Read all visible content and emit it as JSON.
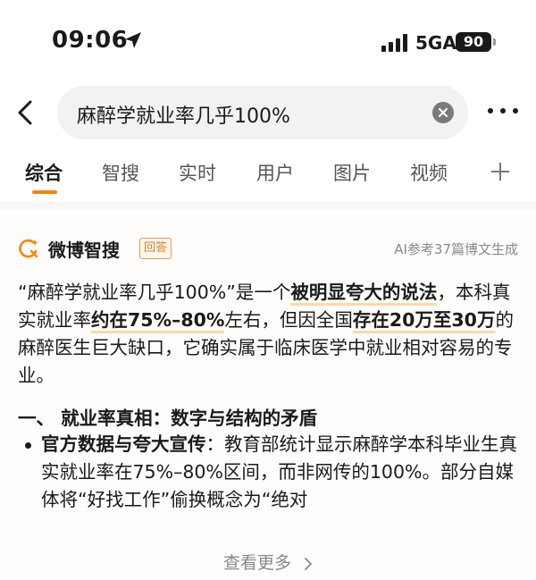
{
  "status_bar": {
    "time": "09:06",
    "network": "5GA",
    "battery": "90"
  },
  "search": {
    "query": "麻醉学就业率几乎100%"
  },
  "tabs": [
    "综合",
    "智搜",
    "实时",
    "用户",
    "图片",
    "视频"
  ],
  "card": {
    "brand": "微博智搜",
    "badge": "回答",
    "ai_note": "AI参考37篇博文生成",
    "intro": {
      "p1": "“麻醉学就业率几乎100%”是一个",
      "h1": "被明显夸大的说法",
      "p2": "，本科真实就业率",
      "h2": "约在75%–80%",
      "p3": "左右，但因全国",
      "h3": "存在20万至30万",
      "p4": "的麻醉医生巨大缺口，它确实属于临床医学中就业相对容易的专业。"
    },
    "heading": "一、 就业率真相：数字与结构的矛盾",
    "bullet": {
      "label": "官方数据与夸大宣传",
      "text": "：教育部统计显示麻醉学本科毕业生真实就业率在75%–80%区间，而非网传的100%。部分自媒体将“好找工作”偷换概念为“绝对"
    },
    "view_more": "查看更多"
  },
  "icons": [
    "location-arrow-icon",
    "signal-icon",
    "back-icon",
    "clear-icon",
    "more-icon",
    "plus-icon",
    "weibo-ai-icon",
    "chevron-right-icon"
  ],
  "colors": {
    "accent": "#ff8200",
    "highlight": "#ffd8a6"
  }
}
